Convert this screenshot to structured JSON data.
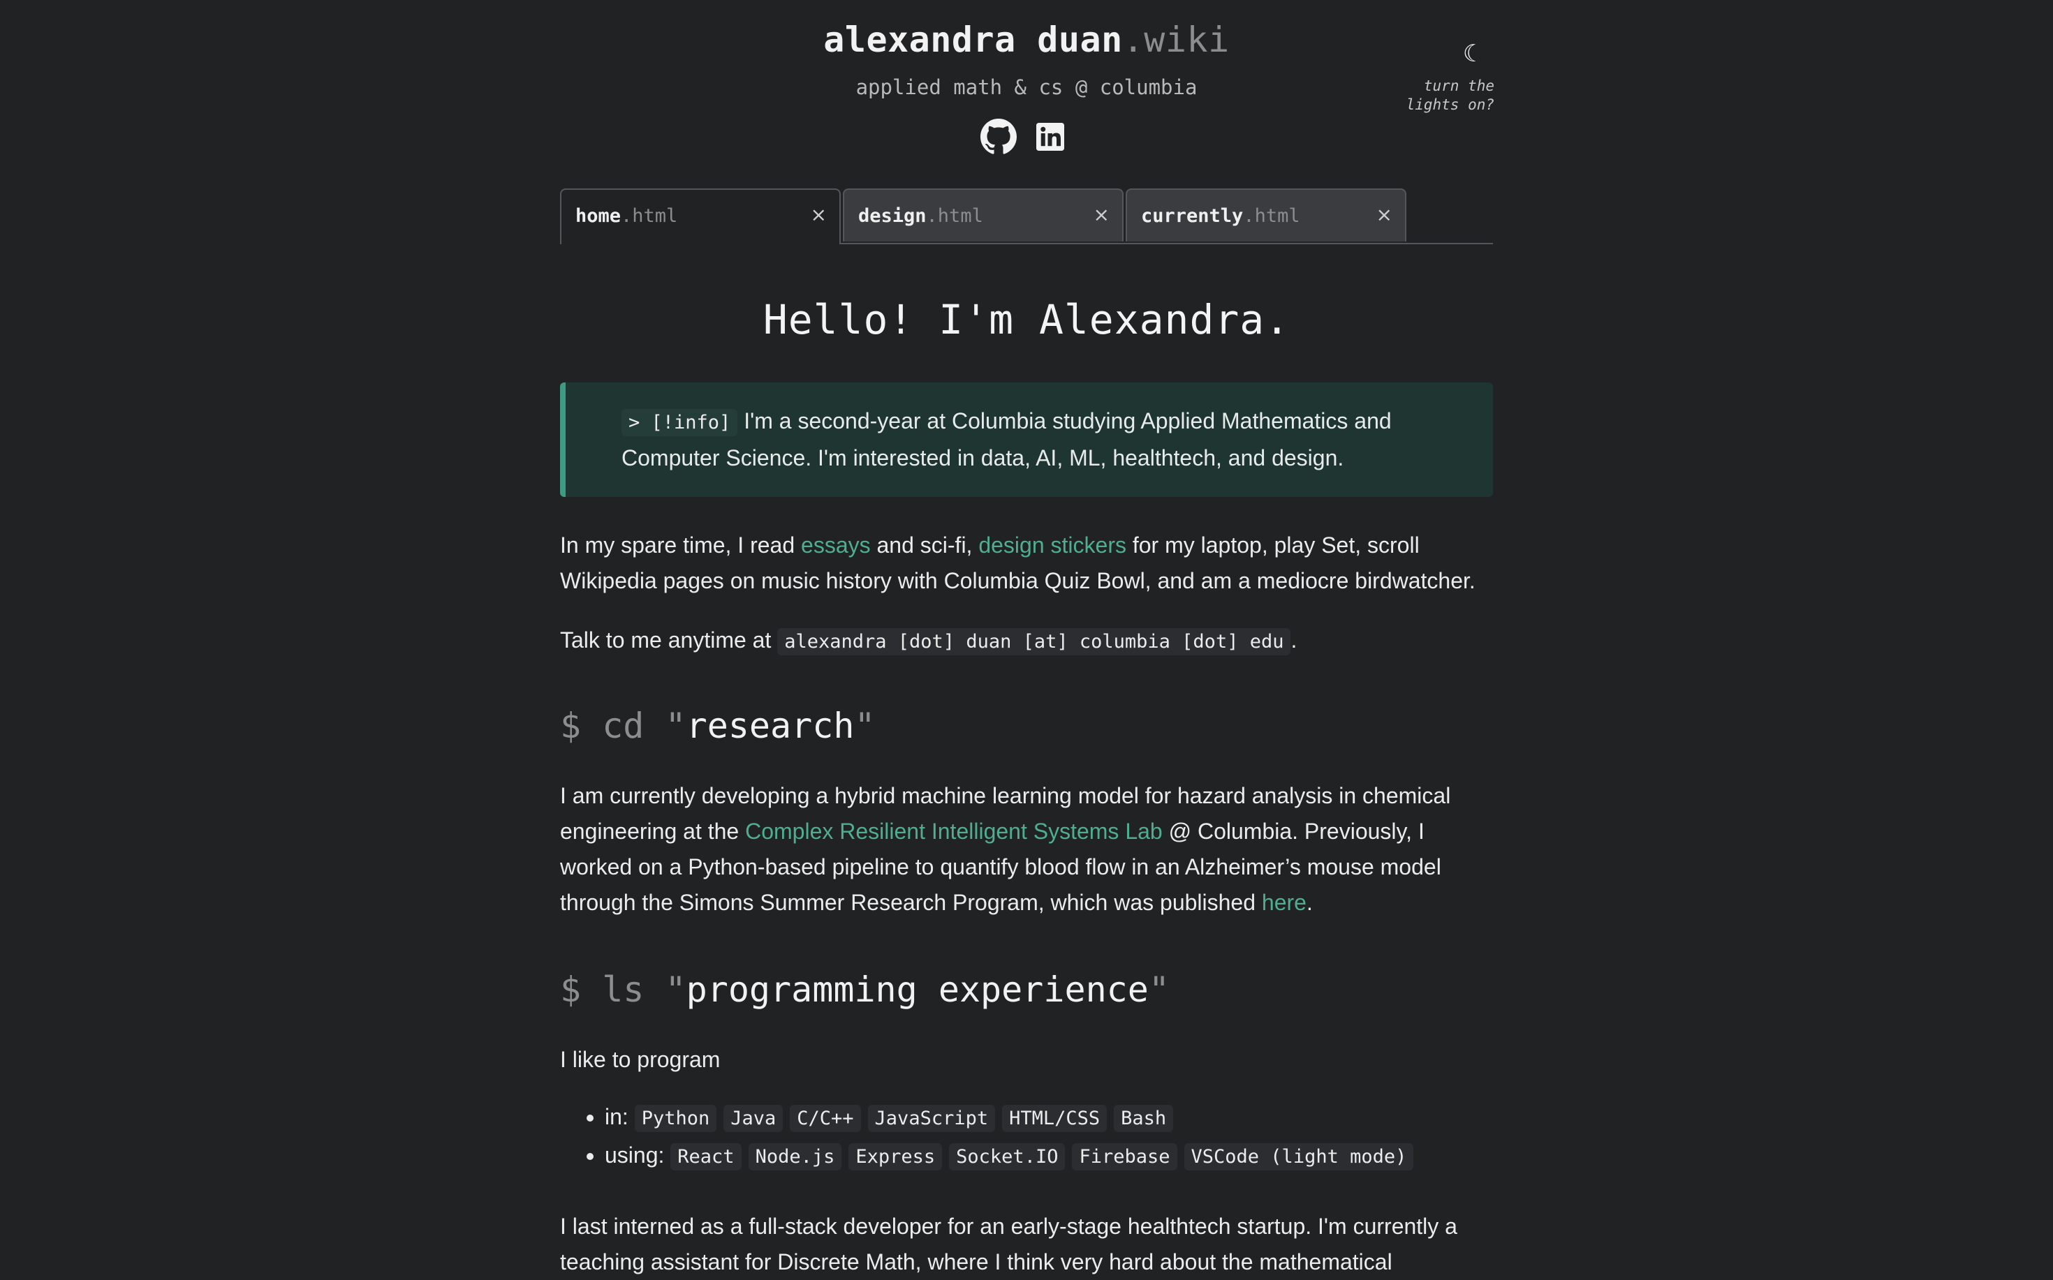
{
  "header": {
    "title_main": "alexandra duan",
    "title_ext": ".wiki",
    "subtitle": "applied math & cs @ columbia",
    "social_icons": [
      "github-icon",
      "linkedin-icon"
    ],
    "theme_toggle_symbol": "☾",
    "theme_hint": "turn the lights on?"
  },
  "tabs": [
    {
      "name": "home",
      "ext": ".html",
      "close": "×",
      "active": true
    },
    {
      "name": "design",
      "ext": ".html",
      "close": "×",
      "active": false
    },
    {
      "name": "currently",
      "ext": ".html",
      "close": "×",
      "active": false
    }
  ],
  "main": {
    "heading": "Hello! I'm Alexandra.",
    "callout": {
      "tag": "> [!info]",
      "text": " I'm a second-year at Columbia studying Applied Mathematics and Computer Science. I'm interested in data, AI, ML, healthtech, and design."
    },
    "spare_time": {
      "t1": "In my spare time, I read ",
      "link1": "essays",
      "t2": " and sci-fi, ",
      "link2": "design stickers",
      "t3": " for my laptop, play Set, scroll Wikipedia pages on music history with Columbia Quiz Bowl, and am a mediocre birdwatcher."
    },
    "contact": {
      "t1": "Talk to me anytime at ",
      "email": "alexandra [dot] duan [at] columbia [dot] edu",
      "t2": "."
    },
    "research": {
      "prompt": "$ cd \"",
      "title": "research",
      "close_quote": "\"",
      "t1": "I am currently developing a hybrid machine learning model for hazard analysis in chemical engineering at the ",
      "link1": "Complex Resilient Intelligent Systems Lab",
      "t2": " @ Columbia. Previously, I worked on a Python-based pipeline to quantify blood flow in an Alzheimer’s mouse model through the Simons Summer Research Program, which was published ",
      "link2": "here",
      "t3": "."
    },
    "programming": {
      "prompt": "$ ls \"",
      "title": "programming experience",
      "close_quote": "\"",
      "intro": "I like to program",
      "in_label": "in: ",
      "languages": [
        "Python",
        "Java",
        "C/C++",
        "JavaScript",
        "HTML/CSS",
        "Bash"
      ],
      "using_label": "using: ",
      "tools": [
        "React",
        "Node.js",
        "Express",
        "Socket.IO",
        "Firebase",
        "VSCode (light mode)"
      ]
    },
    "internship": "I last interned as a full-stack developer for an early-stage healthtech startup. I'm currently a teaching assistant for Discrete Math, where I think very hard about the mathematical"
  },
  "colors": {
    "background": "#212224",
    "accent_link": "#4fae8f",
    "callout_bg": "#1f3531",
    "callout_border": "#3e9a83",
    "muted": "#8d8d8f"
  }
}
